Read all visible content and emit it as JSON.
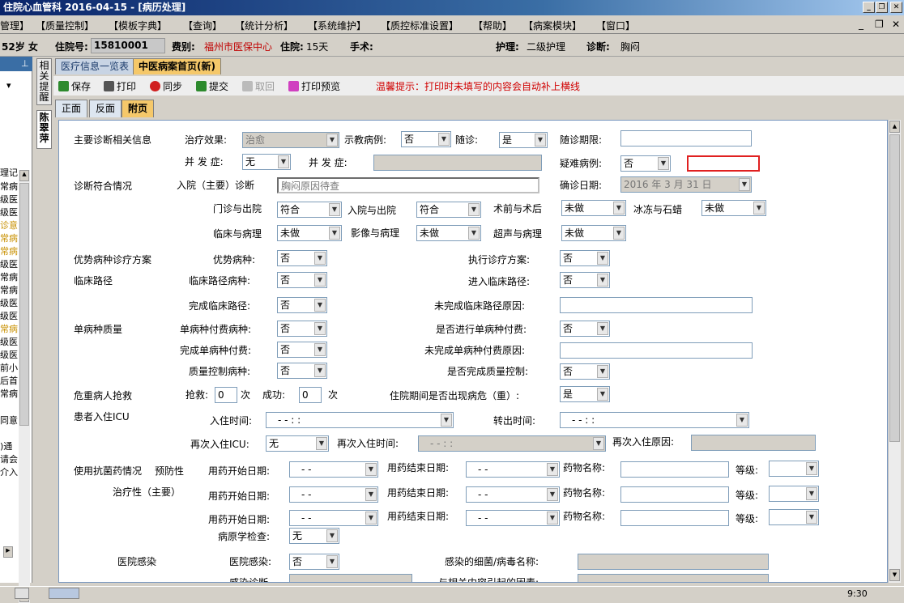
{
  "window": {
    "title": "住院心血管科   2016-04-15 - [病历处理]"
  },
  "menu": [
    "管理】",
    "【质量控制】",
    "【模板字典】",
    "【查询】",
    "【统计分析】",
    "【系统维护】",
    "【质控标准设置】",
    "【帮助】",
    "【病案模块】",
    "【窗口】"
  ],
  "patient": {
    "age_sex": "52岁  女",
    "inpatient_no_label": "住院号:",
    "inpatient_no": "15810001",
    "fee_label": "费别:",
    "fee": "福州市医保中心",
    "stay_label": "住院:",
    "stay": "15天",
    "surgery_label": "手术:",
    "nursing_label": "护理:",
    "nursing": "二级护理",
    "diagnosis_label": "诊断:",
    "diagnosis": "胸闷"
  },
  "side_tabs": [
    "相关提醒",
    "陈翠萍"
  ],
  "left_items": [
    "理记录",
    "常病",
    "级医",
    "级医",
    "诊意",
    "常病",
    "常病",
    "级医",
    "常病",
    "常病",
    "级医",
    "级医",
    "常病",
    "级医",
    "级医",
    "前小",
    "后首",
    "常病",
    "同意",
    ")通",
    "请会",
    "介入"
  ],
  "doc_tabs": [
    "医疗信息一览表",
    "中医病案首页(新)"
  ],
  "toolbar": {
    "save": "保存",
    "print": "打印",
    "sync": "同步",
    "submit": "提交",
    "withdraw": "取回",
    "preview": "打印预览",
    "hint": "温馨提示：打印时未填写的内容会自动补上横线"
  },
  "sub_tabs": [
    "正面",
    "反面",
    "附页"
  ],
  "form": {
    "sec_main_dx": "主要诊断相关信息",
    "effect_label": "治疗效果:",
    "effect": "治愈",
    "demo_label": "示教病例:",
    "demo": "否",
    "followup_label": "随诊:",
    "followup": "是",
    "followup_period_label": "随诊期限:",
    "complication_label1": "并 发 症:",
    "complication": "无",
    "complication_label2": "并 发 症:",
    "difficult_label": "疑难病例:",
    "difficult": "否",
    "sec_dx_match": "诊断符合情况",
    "admit_dx_label": "入院（主要）诊断",
    "admit_dx": "胸闷原因待查",
    "confirm_date_label": "确诊日期:",
    "confirm_date": "2016 年 3 月 31 日",
    "op_out_label": "门诊与出院",
    "op_out": "符合",
    "in_out_label": "入院与出院",
    "in_out": "符合",
    "pre_post_label": "术前与术后",
    "pre_post": "未做",
    "frozen_label": "冰冻与石蜡",
    "frozen": "未做",
    "clin_path_label": "临床与病理",
    "clin_path": "未做",
    "img_path_label": "影像与病理",
    "img_path": "未做",
    "us_path_label": "超声与病理",
    "us_path": "未做",
    "sec_advantage": "优势病种诊疗方案",
    "adv_dz_label": "优势病种:",
    "adv_dz": "否",
    "exec_plan_label": "执行诊疗方案:",
    "exec_plan": "否",
    "sec_clinpath": "临床路径",
    "cp_dz_label": "临床路径病种:",
    "cp_dz": "否",
    "enter_cp_label": "进入临床路径:",
    "enter_cp": "否",
    "done_cp_label": "完成临床路径:",
    "done_cp": "否",
    "undone_cp_reason_label": "未完成临床路径原因:",
    "sec_single": "单病种质量",
    "single_fee_dz_label": "单病种付费病种:",
    "single_fee_dz": "否",
    "single_fee_do_label": "是否进行单病种付费:",
    "single_fee_do": "否",
    "single_fee_done_label": "完成单病种付费:",
    "single_fee_done": "否",
    "single_fee_undone_label": "未完成单病种付费原因:",
    "qc_dz_label": "质量控制病种:",
    "qc_dz": "否",
    "qc_done_label": "是否完成质量控制:",
    "qc_done": "否",
    "sec_rescue": "危重病人抢救",
    "rescue_label": "抢救:",
    "rescue": "0",
    "times1": "次",
    "success_label": "成功:",
    "success": "0",
    "times2": "次",
    "critical_label": "住院期间是否出现病危（重）:",
    "critical": "是",
    "sec_icu": "患者入住ICU",
    "icu_in_label": "入住时间:",
    "icu_in": "-   -          :   :",
    "icu_out_label": "转出时间:",
    "icu_out": "-   -          :   :",
    "icu_re_label": "再次入住ICU:",
    "icu_re": "无",
    "icu_re_time_label": "再次入住时间:",
    "icu_re_time": "-   -          :   :",
    "icu_re_reason_label": "再次入住原因:",
    "sec_antibio": "使用抗菌药情况",
    "prevent_label": "预防性",
    "treat_label": "治疗性（主要）",
    "drug_start_label": "用药开始日期:",
    "drug_start": "-   -",
    "drug_end_label": "用药结束日期:",
    "drug_end": "-   -",
    "drug_name_label": "药物名称:",
    "grade_label": "等级:",
    "pathogen_label": "病原学检查:",
    "pathogen": "无",
    "sec_infect": "医院感染",
    "infect_label": "医院感染:",
    "infect": "否",
    "bacteria_label": "感染的细菌/病毒名称:",
    "infect_dx_label": "感染诊断",
    "related_label": "与相关内容引起的因素:"
  },
  "taskbar": {
    "time": "9:30"
  }
}
